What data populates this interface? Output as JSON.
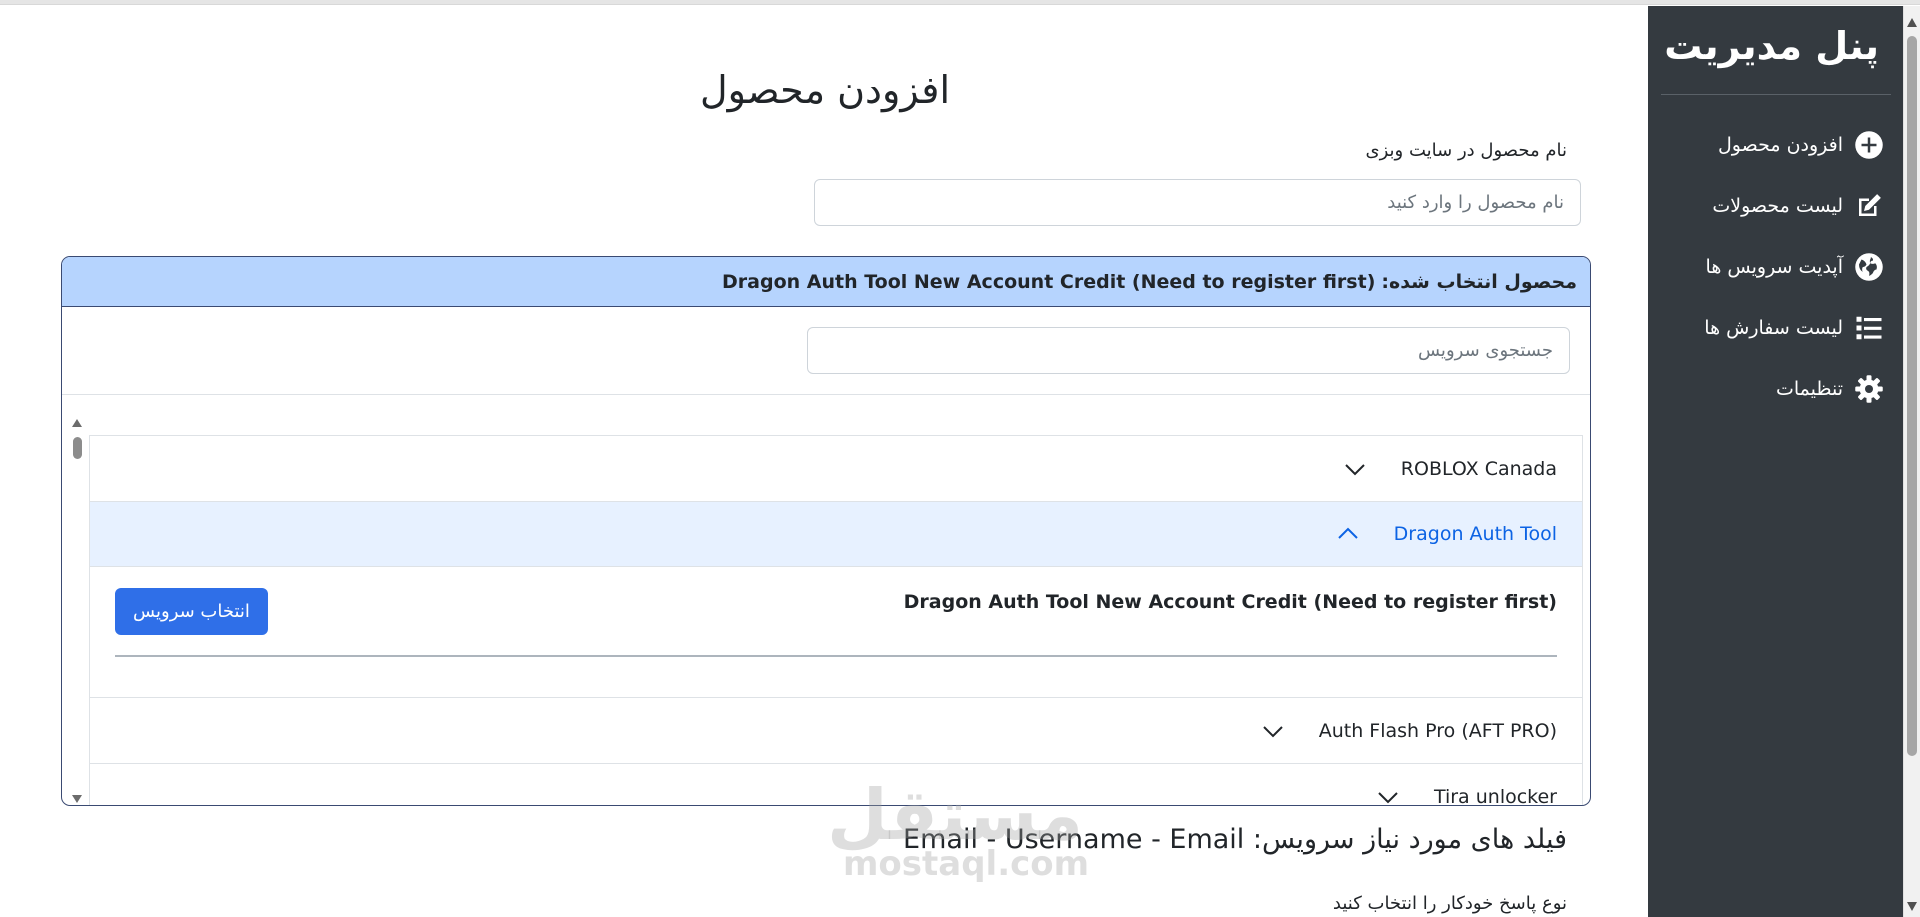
{
  "sidebar": {
    "title": "پنل مدیریت",
    "items": [
      {
        "label": "افزودن محصول",
        "icon": "plus-circle-icon"
      },
      {
        "label": "لیست محصولات",
        "icon": "edit-icon"
      },
      {
        "label": "آپدیت سرویس ها",
        "icon": "globe-icon"
      },
      {
        "label": "لیست سفارش ها",
        "icon": "list-icon"
      },
      {
        "label": "تنظیمات",
        "icon": "gear-icon"
      }
    ]
  },
  "main": {
    "title": "افزودن محصول",
    "product_name_label": "نام محصول در سایت وبزی",
    "product_name_placeholder": "نام محصول را وارد کنید",
    "selected_prefix": "محصول انتخاب شده:",
    "selected_value": "Dragon Auth Tool New Account Credit (Need to register first)",
    "search_placeholder": "جستجوی سرویس",
    "services": [
      {
        "label": "ROBLOX Canada",
        "open": false
      },
      {
        "label": "Dragon Auth Tool",
        "open": true,
        "child": "Dragon Auth Tool New Account Credit (Need to register first)",
        "select_label": "انتخاب سرویس"
      },
      {
        "label": "Auth Flash Pro (AFT PRO)",
        "open": false
      },
      {
        "label": "Tira unlocker",
        "open": false
      }
    ],
    "fields_prefix": "فیلد های مورد نیاز سرویس:",
    "fields_value": "Email - Username - Email",
    "autoreply_label": "نوع پاسخ خودکار را انتخاب کنید"
  },
  "watermark": {
    "ar": "مستقل",
    "en": "mostaql.com"
  },
  "colors": {
    "sidebar_bg": "#343a40",
    "accent": "#2f6fe8",
    "selected_header_bg": "#b6d4fe",
    "accordion_open_bg": "#e7f1ff"
  }
}
